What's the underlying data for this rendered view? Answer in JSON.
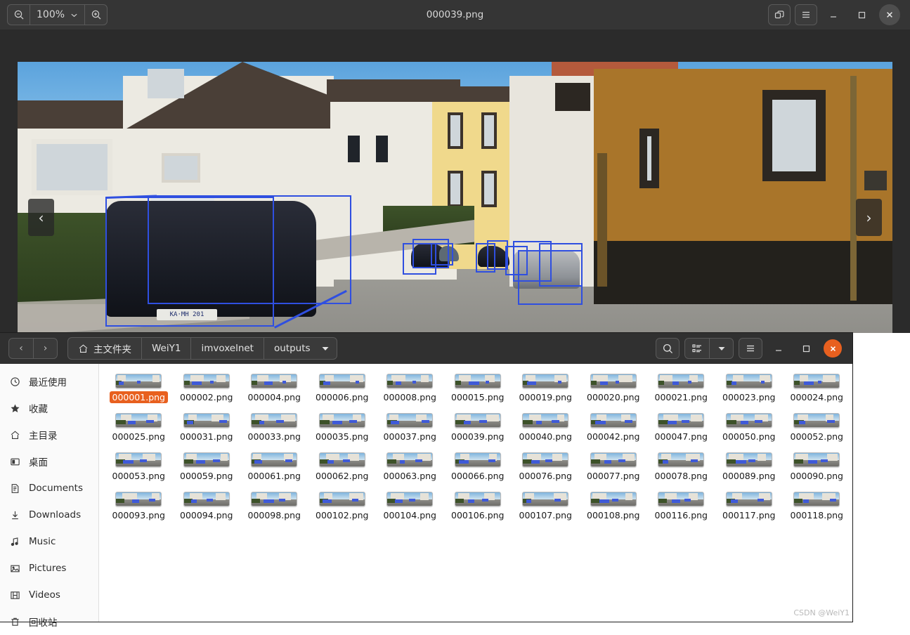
{
  "viewer": {
    "title": "000039.png",
    "zoom_level": "100%",
    "zoom_out_icon": "zoom-out-icon",
    "zoom_in_icon": "zoom-in-icon",
    "zoom_dropdown_icon": "chevron-down-icon",
    "restore_icon": "restore-window-icon",
    "menu_icon": "hamburger-menu-icon",
    "minimize_icon": "minimize-icon",
    "maximize_icon": "maximize-icon",
    "close_icon": "close-icon",
    "prev_arrow": "‹",
    "next_arrow": "›",
    "image_caption": "Street scene with 3D bounding boxes over detected cars",
    "license_plate": "KA·MH 201"
  },
  "filemanager": {
    "back_arrow": "‹",
    "forward_arrow": "›",
    "breadcrumbs": [
      {
        "label": "主文件夹",
        "icon": "home-icon"
      },
      {
        "label": "WeiY1",
        "icon": ""
      },
      {
        "label": "imvoxelnet",
        "icon": ""
      },
      {
        "label": "outputs",
        "icon": "chevron-down-icon"
      }
    ],
    "search_icon": "search-icon",
    "view_list_icon": "list-view-icon",
    "view_dropdown_icon": "chevron-down-icon",
    "menu_icon": "hamburger-menu-icon",
    "minimize_icon": "minimize-icon",
    "maximize_icon": "maximize-icon",
    "close_icon": "close-icon",
    "sidebar": [
      {
        "label": "最近使用",
        "icon": "clock-icon"
      },
      {
        "label": "收藏",
        "icon": "star-icon"
      },
      {
        "label": "主目录",
        "icon": "home-icon"
      },
      {
        "label": "桌面",
        "icon": "desktop-icon"
      },
      {
        "label": "Documents",
        "icon": "document-icon"
      },
      {
        "label": "Downloads",
        "icon": "download-icon"
      },
      {
        "label": "Music",
        "icon": "music-note-icon"
      },
      {
        "label": "Pictures",
        "icon": "picture-icon"
      },
      {
        "label": "Videos",
        "icon": "film-icon"
      },
      {
        "label": "回收站",
        "icon": "trash-icon"
      }
    ],
    "selected_file": "000001.png",
    "files": [
      [
        "000001.png",
        "000002.png",
        "000004.png",
        "000006.png",
        "000008.png",
        "000015.png",
        "000019.png",
        "000020.png",
        "000021.png",
        "000023.png",
        "000024.png"
      ],
      [
        "000025.png",
        "000031.png",
        "000033.png",
        "000035.png",
        "000037.png",
        "000039.png",
        "000040.png",
        "000042.png",
        "000047.png",
        "000050.png",
        "000052.png"
      ],
      [
        "000053.png",
        "000059.png",
        "000061.png",
        "000062.png",
        "000063.png",
        "000066.png",
        "000076.png",
        "000077.png",
        "000078.png",
        "000089.png",
        "000090.png"
      ],
      [
        "000093.png",
        "000094.png",
        "000098.png",
        "000102.png",
        "000104.png",
        "000106.png",
        "000107.png",
        "000108.png",
        "000116.png",
        "000117.png",
        "000118.png"
      ]
    ]
  },
  "watermark": "CSDN @WeiY1",
  "colors": {
    "accent_orange": "#e8601f",
    "bbox_blue": "#2f4fe0",
    "titlebar_dark": "#353535",
    "fm_header_dark": "#303030"
  }
}
